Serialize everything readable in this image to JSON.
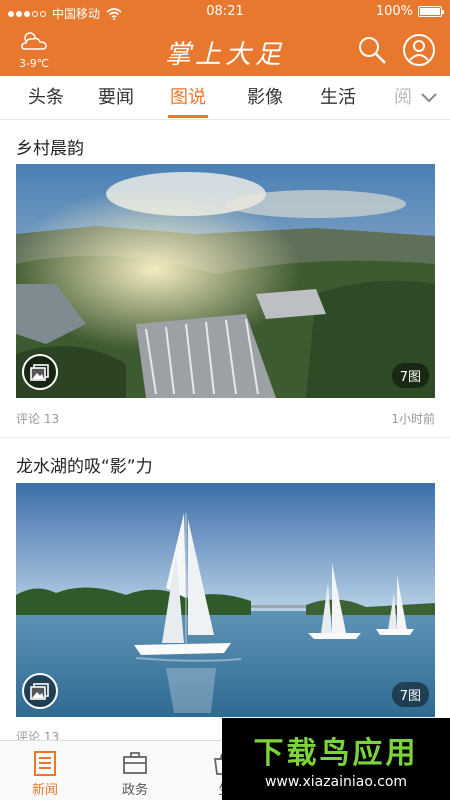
{
  "status_bar": {
    "carrier": "中国移动",
    "time": "08:21",
    "battery": "100%"
  },
  "header": {
    "temperature": "3-9℃",
    "logo_text": "掌上大足"
  },
  "tabs": [
    {
      "label": "头条"
    },
    {
      "label": "要闻"
    },
    {
      "label": "图说",
      "active": true
    },
    {
      "label": "影像"
    },
    {
      "label": "生活"
    },
    {
      "label": "阅"
    }
  ],
  "articles": [
    {
      "title": "乡村晨韵",
      "image_count": "7图",
      "comments": "评论 13",
      "time": "1小时前"
    },
    {
      "title": "龙水湖的吸“影”力",
      "image_count": "7图",
      "comments": "评论 13",
      "time": ""
    }
  ],
  "bottom_nav": [
    {
      "label": "新闻",
      "icon": "newspaper-icon",
      "active": true
    },
    {
      "label": "政务",
      "icon": "briefcase-icon"
    },
    {
      "label": "生",
      "icon": "shop-icon"
    }
  ],
  "watermark": {
    "title": "下载鸟应用",
    "url": "www.xiazainiao.com"
  },
  "colors": {
    "accent": "#e9782f",
    "watermark_green": "#7cd43a"
  }
}
